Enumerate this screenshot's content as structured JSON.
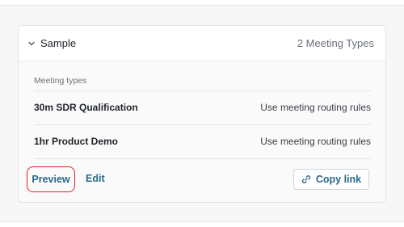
{
  "group": {
    "name": "Sample",
    "count_label": "2 Meeting Types",
    "chevron_icon": "chevron-down-icon"
  },
  "section": {
    "label": "Meeting types"
  },
  "meeting_types": [
    {
      "name": "30m SDR Qualification",
      "routing": "Use meeting routing rules"
    },
    {
      "name": "1hr Product Demo",
      "routing": "Use meeting routing rules"
    }
  ],
  "actions": {
    "preview_label": "Preview",
    "edit_label": "Edit",
    "copy_link_label": "Copy link",
    "copy_link_icon": "link-icon"
  },
  "colors": {
    "accent_text": "#2a6a8a",
    "highlight_border": "#e0202a"
  }
}
